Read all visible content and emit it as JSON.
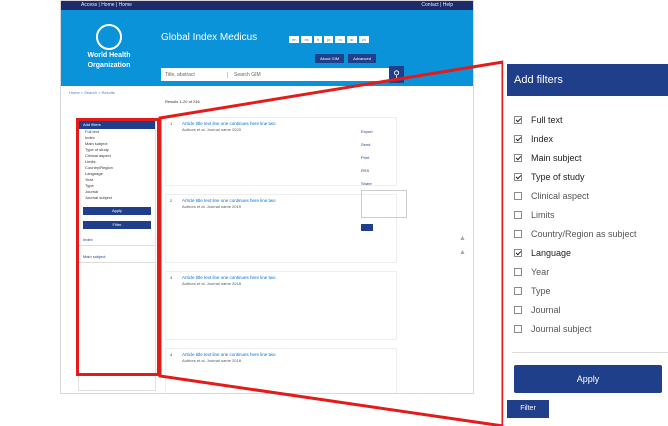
{
  "topbar": {
    "left_text": "Access | Home | Home",
    "right_text": "Contact | Help"
  },
  "header": {
    "logo_line1": "World Health",
    "logo_line2": "Organization",
    "site_title": "Global Index Medicus",
    "languages": [
      "en",
      "es",
      "fr",
      "pt",
      "ru",
      "ar",
      "zh"
    ],
    "buttons": [
      "About GIM",
      "Advanced"
    ]
  },
  "search": {
    "scope": "Title, abstract",
    "query": "Search GIM",
    "button_icon": "search-icon"
  },
  "breadcrumb": "Home > Search > Results",
  "left_panel": {
    "title": "Add filters",
    "rows": [
      "Full text",
      "Index",
      "Main subject",
      "Type of study",
      "Clinical aspect",
      "Limits",
      "Country/Region",
      "Language",
      "Year",
      "Type",
      "Journal",
      "Journal subject"
    ],
    "apply": "Apply",
    "filter": "Filter",
    "sections": [
      "Index",
      "Main subject"
    ]
  },
  "results": {
    "toolbar": "Results 1-20 of 246",
    "items": [
      {
        "num": "1",
        "title": "Article title text line one continues here line two",
        "meta": "Authors et al. Journal name 2020"
      },
      {
        "num": "2",
        "title": "Article title text line one continues here line two",
        "meta": "Authors et al. Journal name 2019"
      },
      {
        "num": "3",
        "title": "Article title text line one continues here line two",
        "meta": "Authors et al. Journal name 2018"
      },
      {
        "num": "4",
        "title": "Article title text line one continues here line two",
        "meta": "Authors et al. Journal name 2018"
      }
    ]
  },
  "right_panel": {
    "rows": [
      "Export",
      "Send",
      "Print",
      "RSS",
      "Share"
    ]
  },
  "filters_panel": {
    "title": "Add filters",
    "filters": [
      {
        "label": "Full text",
        "checked": true
      },
      {
        "label": "Index",
        "checked": true
      },
      {
        "label": "Main subject",
        "checked": true
      },
      {
        "label": "Type of study",
        "checked": true
      },
      {
        "label": "Clinical aspect",
        "checked": false
      },
      {
        "label": "Limits",
        "checked": false
      },
      {
        "label": "Country/Region as subject",
        "checked": false
      },
      {
        "label": "Language",
        "checked": true
      },
      {
        "label": "Year",
        "checked": false
      },
      {
        "label": "Type",
        "checked": false
      },
      {
        "label": "Journal",
        "checked": false
      },
      {
        "label": "Journal subject",
        "checked": false
      }
    ],
    "apply_label": "Apply",
    "filter_label": "Filter"
  },
  "colors": {
    "header_blue": "#0a93d8",
    "navy": "#1f3f8a",
    "callout_red": "#e21b1b"
  }
}
